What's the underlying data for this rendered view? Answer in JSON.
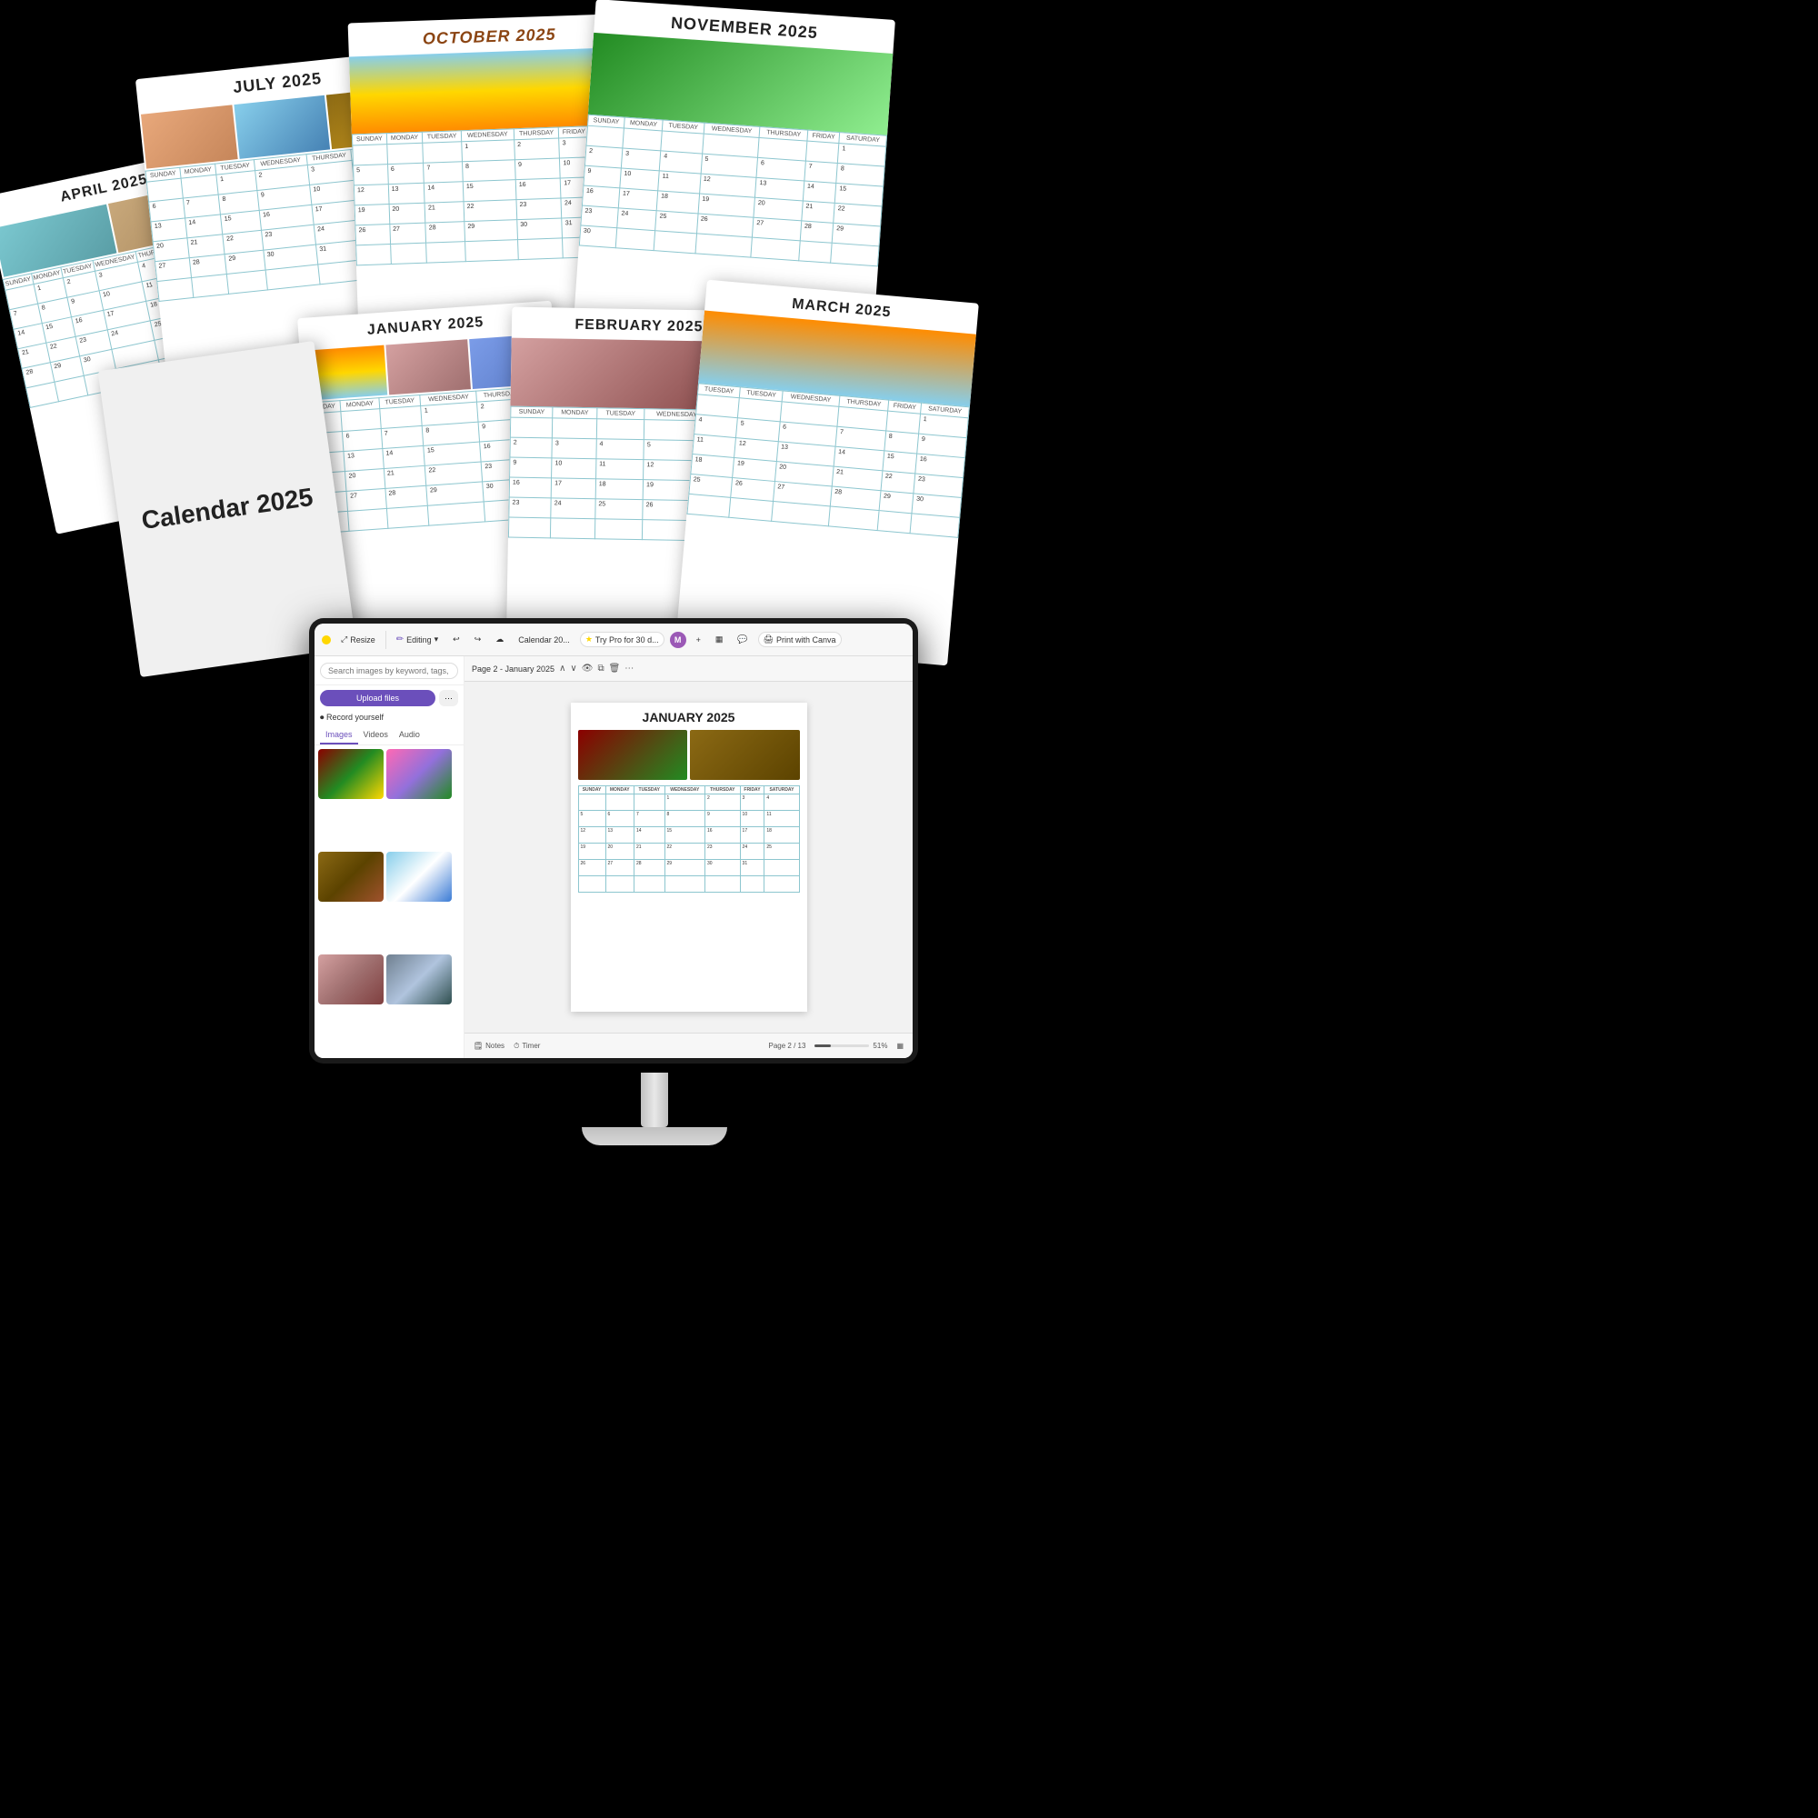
{
  "background": "#000000",
  "pages": {
    "april": {
      "title": "APRIL 2025",
      "months": [
        "SUNDAY",
        "MONDAY",
        "TUESDAY",
        "WEDNESDAY",
        "THURSDAY"
      ],
      "photo_type": "family"
    },
    "july": {
      "title": "JULY 2025",
      "photo_type": "summer"
    },
    "october": {
      "title": "OCTOBER 2025",
      "photo_type": "autumn"
    },
    "november": {
      "title": "NOVEMBER 2025",
      "photo_type": "nature"
    },
    "january": {
      "title": "JANUARY 2025",
      "photo_type": "sunset"
    },
    "february": {
      "title": "FEBRUARY 2025",
      "photo_type": "couple"
    },
    "march": {
      "title": "MARCH 2025",
      "photo_type": "outdoor"
    },
    "cover": {
      "title": "Calendar\n2025"
    }
  },
  "monitor": {
    "topbar": {
      "resize_label": "Resize",
      "editing_label": "Editing",
      "undo_icon": "↩",
      "redo_icon": "↪",
      "cloud_icon": "☁",
      "file_name": "Calendar 20...",
      "try_pro_label": "Try Pro for 30 d...",
      "plus_icon": "+",
      "chart_icon": "📊",
      "comment_icon": "💬",
      "print_label": "Print with Canva"
    },
    "sidebar": {
      "search_placeholder": "Search images by keyword, tags, color...",
      "upload_btn": "Upload files",
      "more_btn": "···",
      "record_label": "Record yourself",
      "tabs": [
        "Images",
        "Videos",
        "Audio"
      ],
      "active_tab": "Images"
    },
    "page_nav": {
      "label": "Page 2 - January 2025"
    },
    "canvas": {
      "title": "JANUARY 2025"
    },
    "bottom_bar": {
      "notes_label": "Notes",
      "timer_label": "Timer",
      "page_counter": "Page 2 / 13",
      "zoom_label": "51%"
    }
  }
}
